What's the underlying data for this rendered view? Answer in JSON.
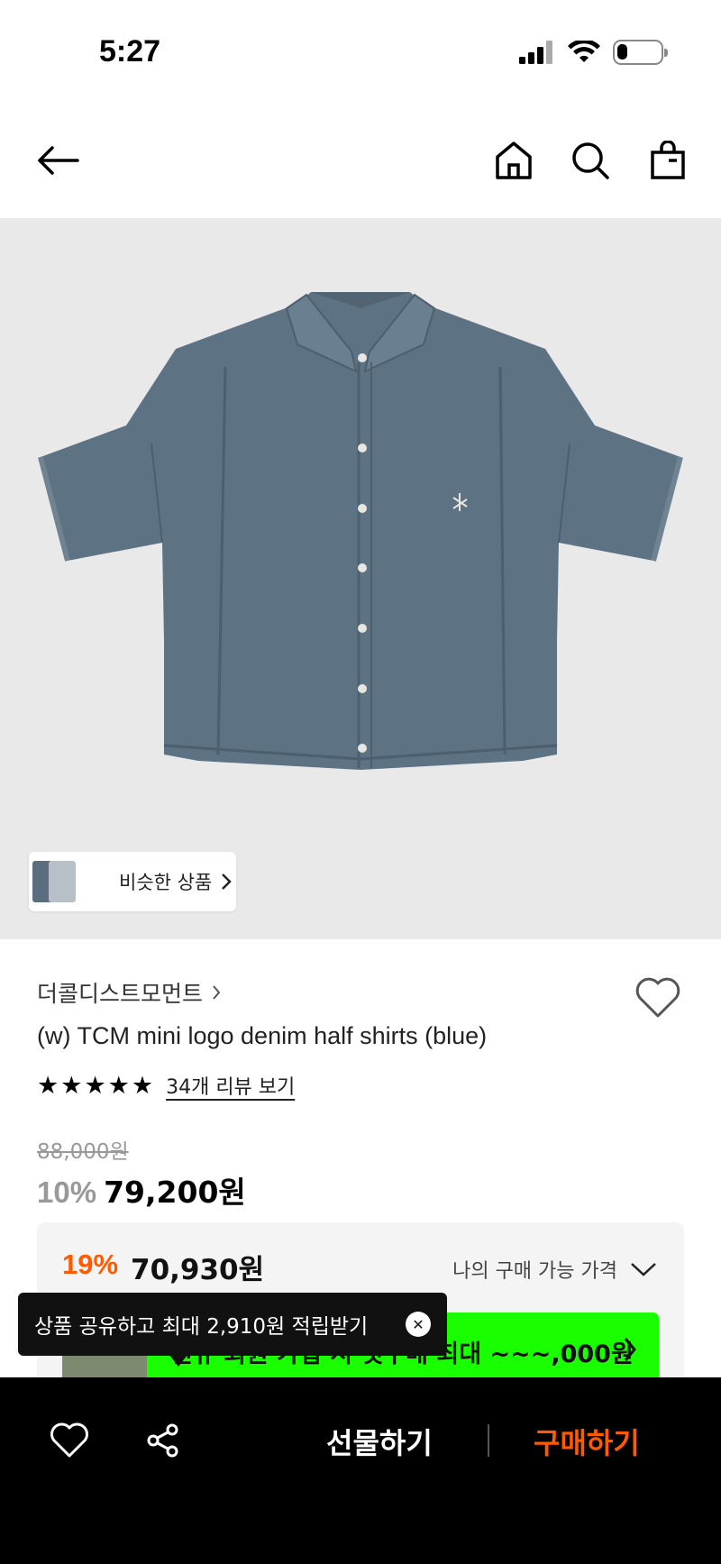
{
  "status_bar": {
    "time": "5:27",
    "battery_level": 0.25,
    "icons": [
      "signal-icon",
      "wifi-icon",
      "battery-icon"
    ]
  },
  "nav": {
    "icons": [
      "back-arrow-icon",
      "home-icon",
      "search-icon",
      "shopping-bag-icon"
    ]
  },
  "image": {
    "similar_label": "비슷한 상품"
  },
  "product": {
    "brand": "더콜디스트모먼트",
    "name": "(w) TCM mini logo denim half shirts (blue)",
    "rating_stars": 5,
    "review_link": "34개 리뷰 보기",
    "original_price": "88,000원",
    "discount": "10%",
    "price": "79,200원"
  },
  "my_price": {
    "discount": "19%",
    "price": "70,930원",
    "label": "나의 구매 가능 가격",
    "banner_text": "신규 회원 가입 시 첫구매 최대 ~~~,000원"
  },
  "tooltip": {
    "text": "상품 공유하고 최대 2,910원 적립받기"
  },
  "bottom_bar": {
    "gift_label": "선물하기",
    "buy_label": "구매하기"
  },
  "colors": {
    "accent": "#ff5a00",
    "banner_green": "#19ff00",
    "image_bg": "#e9e9ea",
    "denim": "#5d7283"
  }
}
